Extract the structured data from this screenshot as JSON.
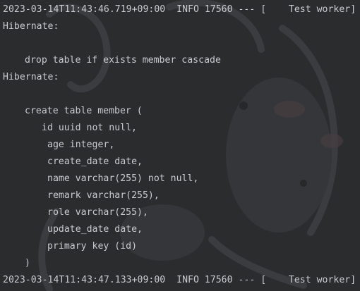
{
  "console": {
    "lines": [
      "2023-03-14T11:43:46.719+09:00  INFO 17560 --- [    Test worker]",
      "Hibernate:",
      "",
      "drop table if exists member cascade",
      "Hibernate:",
      "",
      "create table member (",
      "id uuid not null,",
      "age integer,",
      "create_date date,",
      "name varchar(255) not null,",
      "remark varchar(255),",
      "role varchar(255),",
      "update_date date,",
      "primary key (id)",
      ")",
      "2023-03-14T11:43:47.133+09:00  INFO 17560 --- [    Test worker]"
    ]
  },
  "background": {
    "art_color": "#3a3c3f",
    "cheek_color": "#5a4a4c"
  }
}
